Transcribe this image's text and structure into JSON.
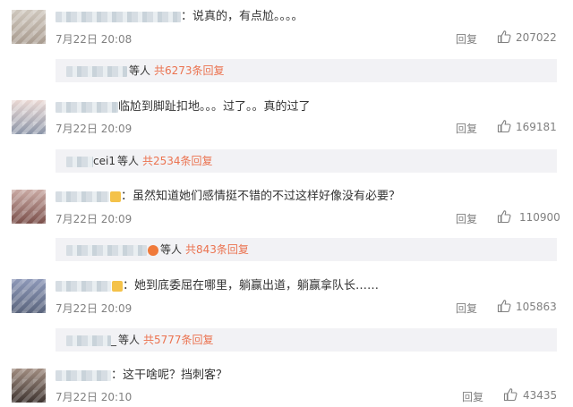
{
  "comments": [
    {
      "name_suffix": "",
      "text": "：说真的，有点尬。。。。",
      "time": "7月22日 20:08",
      "reply_label": "回复",
      "likes": "207022",
      "sub_name_suffix": "",
      "sub_etc": "等人",
      "sub_total": "共6273条回复"
    },
    {
      "name_suffix": "",
      "text": "临尬到脚趾扣地。。。过了。。真的过了",
      "time": "7月22日 20:09",
      "reply_label": "回复",
      "likes": "169181",
      "sub_name_suffix": "cei1",
      "sub_etc": "等人",
      "sub_total": "共2534条回复"
    },
    {
      "name_suffix": "",
      "text": "：虽然知道她们感情挺不错的不过这样好像没有必要？",
      "time": "7月22日 20:09",
      "reply_label": "回复",
      "likes": "110900",
      "sub_name_suffix": "",
      "sub_etc": "等人",
      "sub_total": "共843条回复"
    },
    {
      "name_suffix": "",
      "text": "：她到底委屈在哪里，躺赢出道，躺赢拿队长……",
      "time": "7月22日 20:09",
      "reply_label": "回复",
      "likes": "105863",
      "sub_name_suffix": "_",
      "sub_etc": "等人",
      "sub_total": "共5777条回复"
    },
    {
      "name_suffix": "",
      "text": "：这干啥呢？挡刺客？",
      "time": "7月22日 20:10",
      "reply_label": "回复",
      "likes": "43435"
    }
  ],
  "colors": {
    "accent": "#eb7350",
    "meta": "#808080",
    "subbox_bg": "#f2f2f5"
  },
  "icons": {
    "like": "thumbs-up-icon"
  }
}
